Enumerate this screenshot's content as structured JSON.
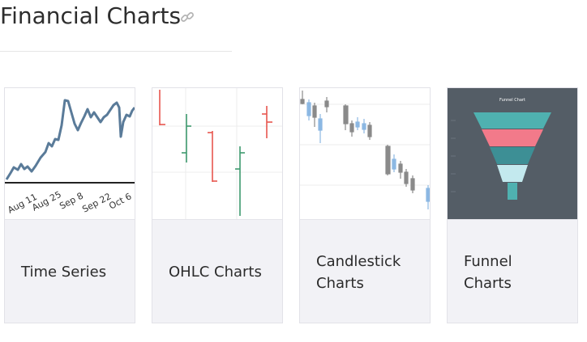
{
  "section": {
    "title": "Financial Charts",
    "link_icon": "link-icon"
  },
  "cards": [
    {
      "label": "Time Series",
      "thumbnail": {
        "x_ticks": [
          "Aug 11",
          "Aug 25",
          "Sep 8",
          "Sep 22",
          "Oct 6"
        ],
        "line_color": "#5a7b99"
      }
    },
    {
      "label": "OHLC Charts",
      "thumbnail": {
        "up_color": "#3e9a6e",
        "down_color": "#e8574f"
      }
    },
    {
      "label": "Candlestick Charts",
      "thumbnail": {
        "up_color": "#8cb8e3",
        "down_color": "#8a8a8a"
      }
    },
    {
      "label": "Funnel Charts",
      "thumbnail": {
        "title": "Funnel Chart",
        "background": "#545d66",
        "band_colors": [
          "#4fb1b0",
          "#f27a8a",
          "#3d8f95",
          "#c3e9ee",
          "#4fb1b0"
        ]
      }
    }
  ]
}
